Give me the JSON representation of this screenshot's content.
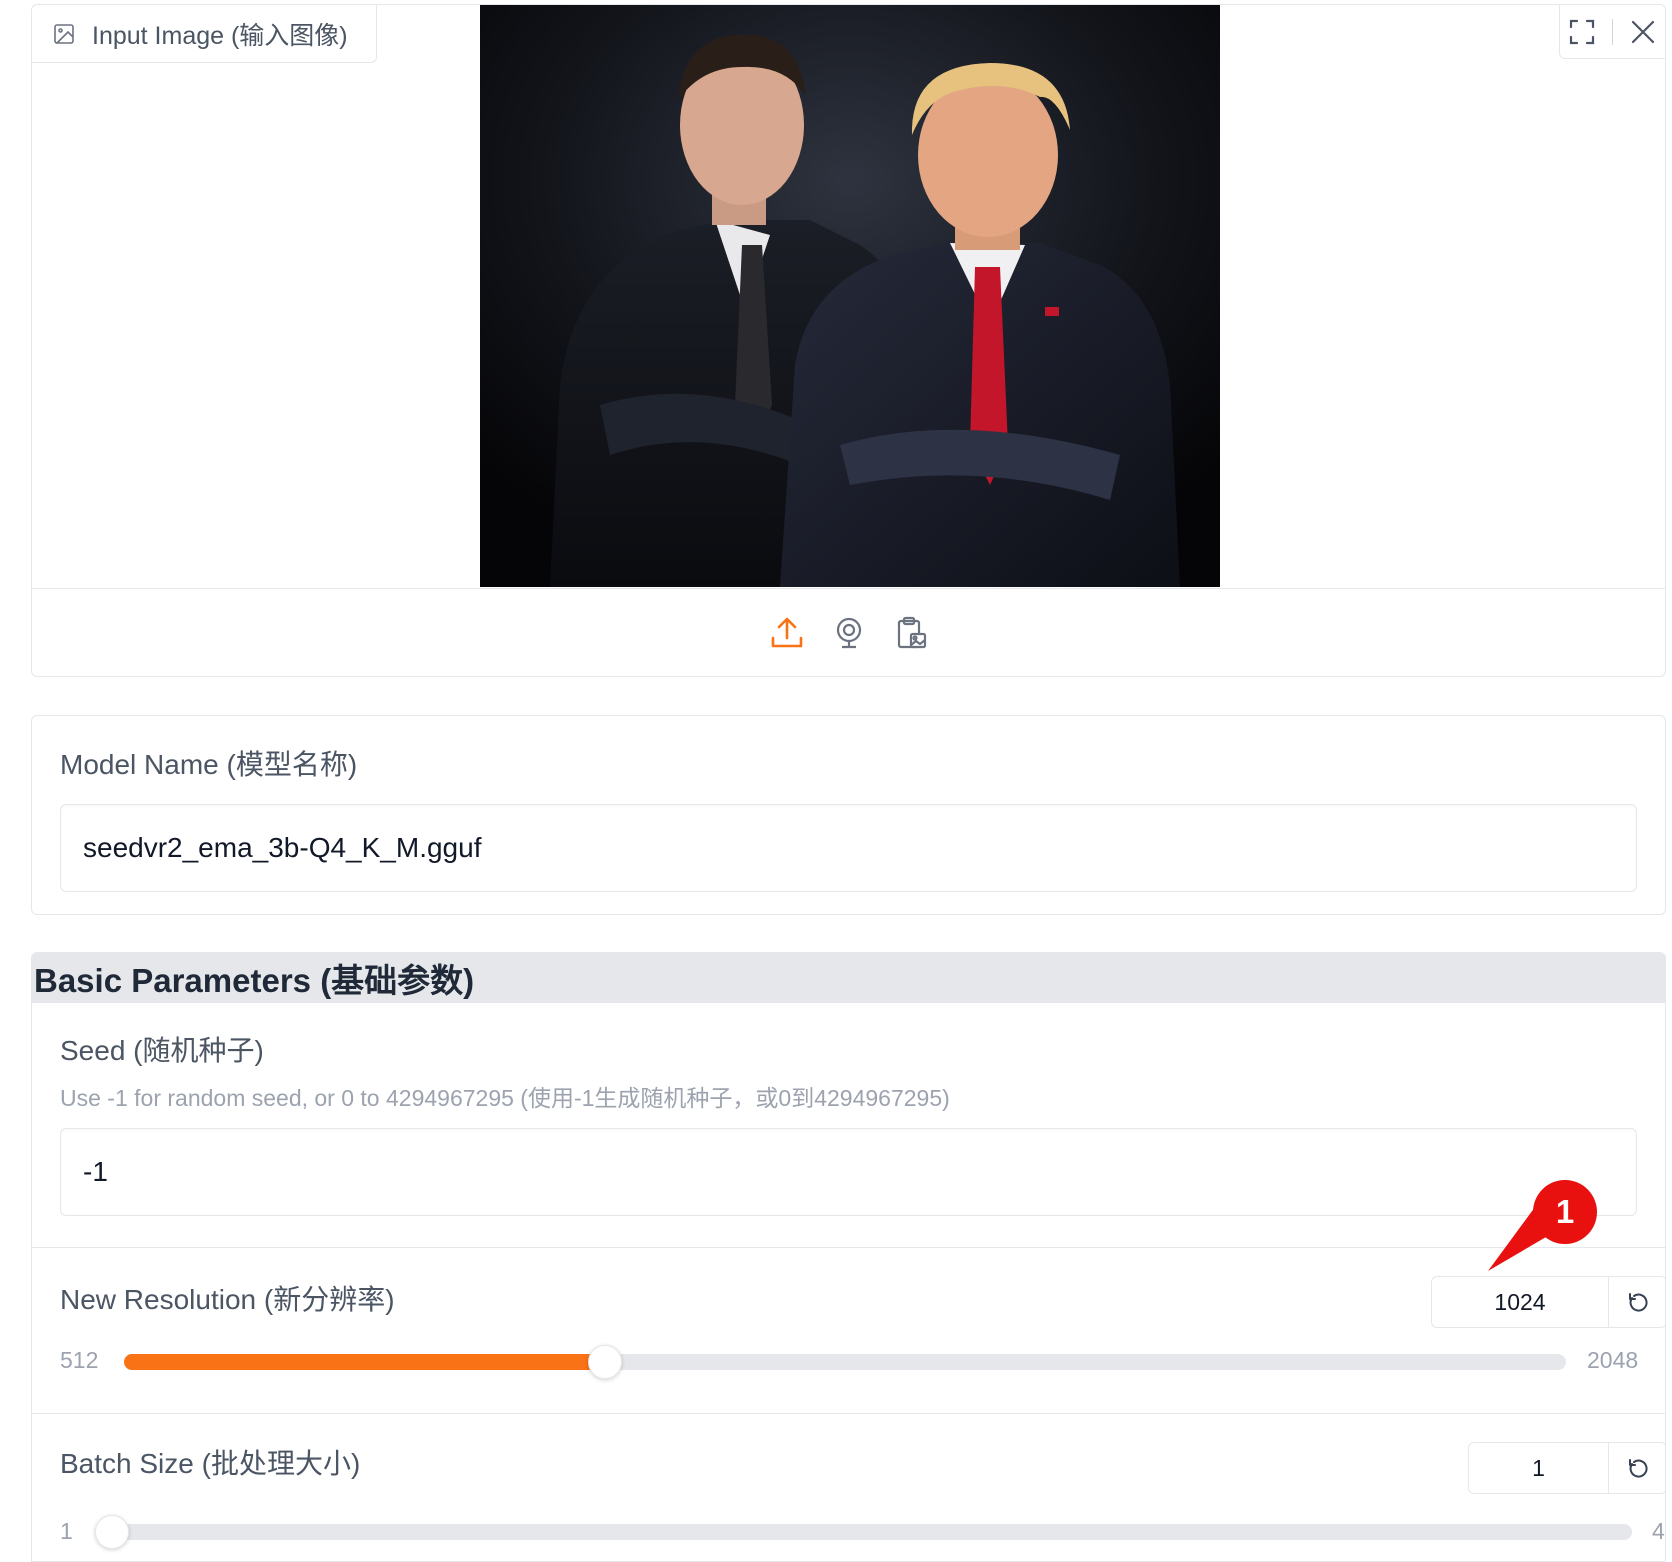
{
  "image_input": {
    "label": "Input Image (输入图像)",
    "label_icon": "image-icon",
    "tools": [
      "fullscreen-icon",
      "close-icon"
    ],
    "sources": [
      "upload-icon",
      "webcam-icon",
      "clipboard-icon"
    ],
    "accent": "#f97316"
  },
  "model": {
    "label": "Model Name (模型名称)",
    "value": "seedvr2_ema_3b-Q4_K_M.gguf"
  },
  "basic_params": {
    "header": "Basic Parameters (基础参数)",
    "seed": {
      "label": "Seed (随机种子)",
      "info": "Use -1 for random seed, or 0 to 4294967295 (使用-1生成随机种子，或0到4294967295)",
      "value": "-1"
    },
    "resolution": {
      "label": "New Resolution (新分辨率)",
      "value": "1024",
      "min": "512",
      "max": "2048",
      "fraction": 0.3333
    },
    "batch": {
      "label": "Batch Size (批处理大小)",
      "value": "1",
      "min": "1",
      "max": "4",
      "fraction": 0
    }
  },
  "annotation": {
    "number": "1",
    "color": "#e8110f"
  }
}
